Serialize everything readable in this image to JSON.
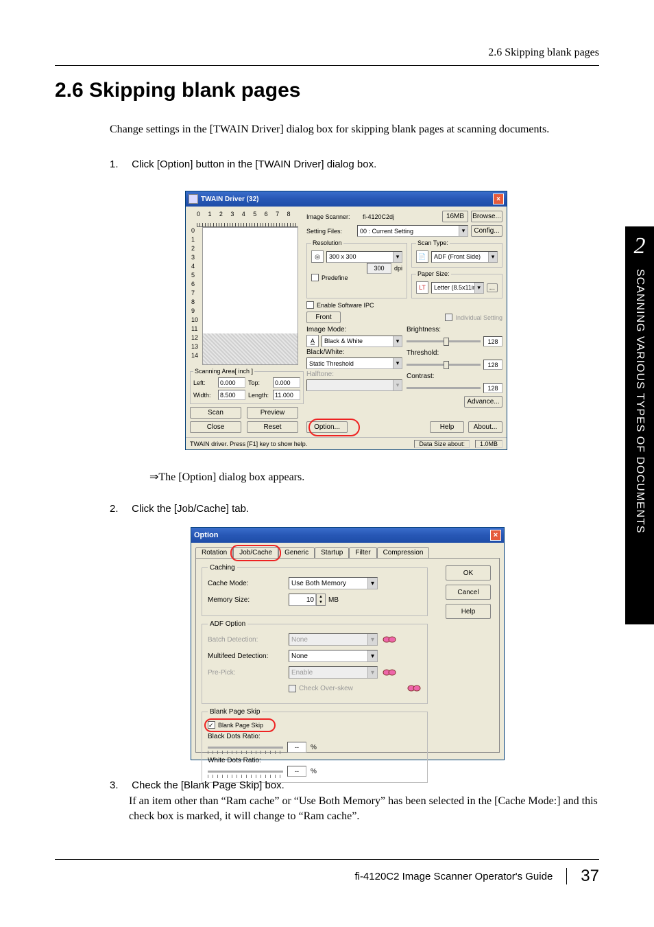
{
  "header": {
    "right": "2.6 Skipping blank pages"
  },
  "section": {
    "heading": "2.6  Skipping blank pages"
  },
  "intro": "Change settings in the [TWAIN Driver] dialog box for skipping blank pages at scanning documents.",
  "step1": {
    "num": "1.",
    "text": "Click [Option] button in the [TWAIN Driver] dialog box."
  },
  "twain": {
    "title": "TWAIN Driver (32)",
    "ruler_h": [
      "0",
      "1",
      "2",
      "3",
      "4",
      "5",
      "6",
      "7",
      "8"
    ],
    "ruler_v": [
      "0",
      "1",
      "2",
      "3",
      "4",
      "5",
      "6",
      "7",
      "8",
      "9",
      "10",
      "11",
      "12",
      "13",
      "14"
    ],
    "scanning_area_legend": "Scanning Area[ inch ]",
    "left_lbl": "Left:",
    "left_val": "0.000",
    "top_lbl": "Top:",
    "top_val": "0.000",
    "width_lbl": "Width:",
    "width_val": "8.500",
    "length_lbl": "Length:",
    "length_val": "11.000",
    "scan": "Scan",
    "preview": "Preview",
    "close": "Close",
    "reset": "Reset",
    "image_scanner_lbl": "Image Scanner:",
    "image_scanner_val": "fi-4120C2dj",
    "mem": "16MB",
    "browse": "Browse...",
    "setting_files_lbl": "Setting Files:",
    "setting_files_val": "00 : Current Setting",
    "config": "Config...",
    "resolution_legend": "Resolution",
    "resolution_val": "300 x 300",
    "resolution_spin": "300",
    "dpi": "dpi",
    "predefine": "Predefine",
    "scan_type_legend": "Scan Type:",
    "scan_type_val": "ADF (Front Side)",
    "paper_size_legend": "Paper Size:",
    "paper_size_val": "Letter (8.5x11in)",
    "enable_ipc": "Enable Software IPC",
    "front": "Front",
    "individual": "Individual Setting",
    "image_mode_lbl": "Image Mode:",
    "image_mode_val": "Black & White",
    "bw_lbl": "Black/White:",
    "bw_val": "Static Threshold",
    "halftone_lbl": "Halftone:",
    "brightness": "Brightness:",
    "threshold": "Threshold:",
    "contrast": "Contrast:",
    "slider_val": "128",
    "advance": "Advance...",
    "option": "Option...",
    "help": "Help",
    "about": "About...",
    "status_left": "TWAIN driver. Press [F1] key to show help.",
    "status_lbl": "Data Size about:",
    "status_val": "1.0MB",
    "ellipsis": "..."
  },
  "result": "⇒The [Option] dialog box appears.",
  "step2": {
    "num": "2.",
    "text": "Click the [Job/Cache] tab."
  },
  "option": {
    "title": "Option",
    "tabs": [
      "Rotation",
      "Job/Cache",
      "Generic",
      "Startup",
      "Filter",
      "Compression"
    ],
    "ok": "OK",
    "cancel": "Cancel",
    "help": "Help",
    "caching_legend": "Caching",
    "cache_mode_lbl": "Cache Mode:",
    "cache_mode_val": "Use Both Memory",
    "memory_size_lbl": "Memory Size:",
    "memory_size_val": "10",
    "mb": "MB",
    "adf_legend": "ADF Option",
    "batch_lbl": "Batch Detection:",
    "batch_val": "None",
    "multi_lbl": "Multifeed Detection:",
    "multi_val": "None",
    "prepick_lbl": "Pre-Pick:",
    "prepick_val": "Enable",
    "overskew": "Check Over-skew",
    "blank_legend": "Blank Page Skip",
    "blank_chk": "Blank Page Skip",
    "black_ratio": "Black Dots Ratio:",
    "white_ratio": "White Dots Ratio:",
    "ratio_val": "--",
    "pct": "%"
  },
  "step3": {
    "num": "3.",
    "head": "Check the [Blank Page Skip] box.",
    "body": "If an item other than “Ram cache” or “Use Both Memory” has been selected in the [Cache Mode:] and this check box is marked, it will change to “Ram cache”."
  },
  "footer": {
    "guide": "fi-4120C2 Image Scanner Operator's Guide",
    "page": "37"
  },
  "side": {
    "chapter": "2",
    "text": "SCANNING VARIOUS TYPES OF DOCUMENTS"
  }
}
